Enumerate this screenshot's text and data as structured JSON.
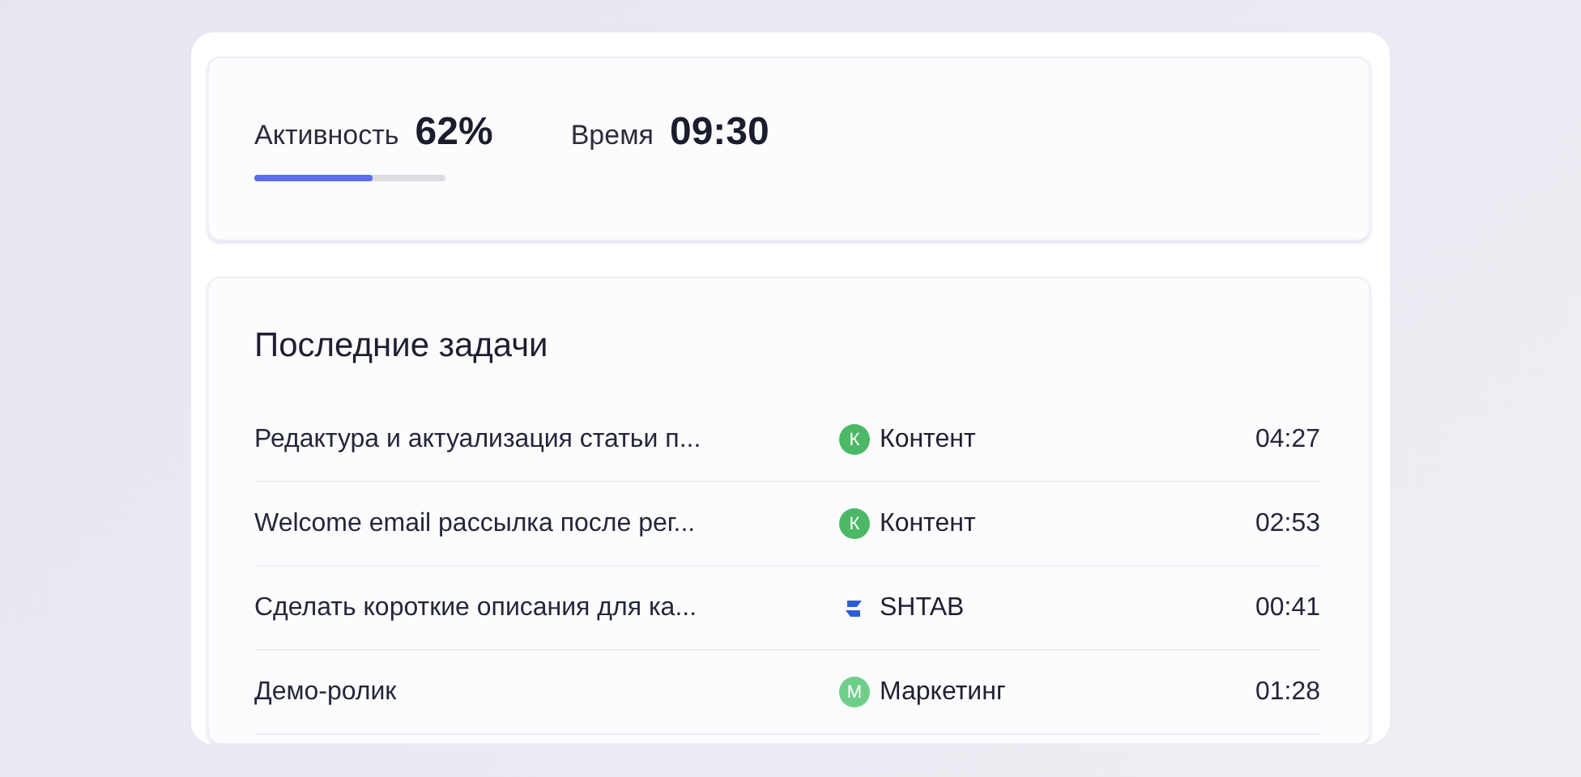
{
  "stats": {
    "activity": {
      "label": "Активность",
      "value": "62%",
      "level": 0.62
    },
    "time": {
      "label": "Время",
      "value": "09:30"
    }
  },
  "recent_tasks": {
    "title": "Последние задачи",
    "rows": [
      {
        "task": "Редактура и актуализация статьи п...",
        "project": {
          "kind": "letter",
          "letter": "К",
          "color": "#4cb866",
          "name": "Контент"
        },
        "time": "04:27"
      },
      {
        "task": "Welcome email рассылка после рег...",
        "project": {
          "kind": "letter",
          "letter": "К",
          "color": "#4cb866",
          "name": "Контент"
        },
        "time": "02:53"
      },
      {
        "task": "Сделать короткие описания для ка...",
        "project": {
          "kind": "logo",
          "name": "SHTAB"
        },
        "time": "00:41"
      },
      {
        "task": "Демо-ролик",
        "project": {
          "kind": "letter",
          "letter": "М",
          "color": "#6fcf8a",
          "name": "Маркетинг"
        },
        "time": "01:28"
      }
    ]
  }
}
